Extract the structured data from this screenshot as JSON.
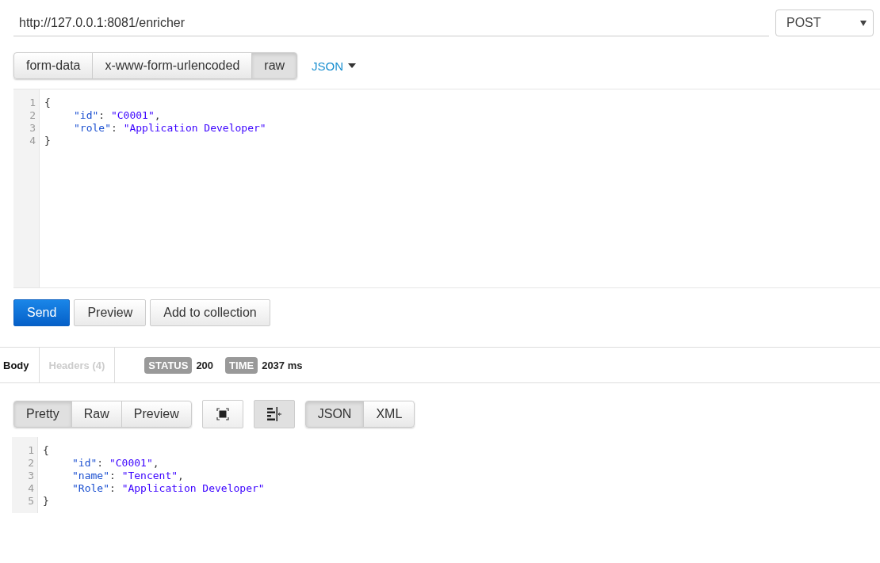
{
  "request": {
    "url": "http://127.0.0.1:8081/enricher",
    "method": "POST"
  },
  "body_modes": [
    {
      "label": "form-data",
      "selected": false
    },
    {
      "label": "x-www-form-urlencoded",
      "selected": false
    },
    {
      "label": "raw",
      "selected": true
    }
  ],
  "raw_type": "JSON",
  "request_body": [
    {
      "number": "1",
      "indented": false,
      "tokens": [
        {
          "kind": "punct",
          "text": "{"
        }
      ]
    },
    {
      "number": "2",
      "indented": true,
      "tokens": [
        {
          "kind": "key",
          "text": "\"id\""
        },
        {
          "kind": "punct",
          "text": ": "
        },
        {
          "kind": "string",
          "text": "\"C0001\""
        },
        {
          "kind": "punct",
          "text": ","
        }
      ]
    },
    {
      "number": "3",
      "indented": true,
      "tokens": [
        {
          "kind": "key",
          "text": "\"role\""
        },
        {
          "kind": "punct",
          "text": ": "
        },
        {
          "kind": "string",
          "text": "\"Application Developer\""
        }
      ]
    },
    {
      "number": "4",
      "indented": false,
      "tokens": [
        {
          "kind": "punct",
          "text": "}"
        }
      ]
    }
  ],
  "actions": [
    {
      "label": "Send",
      "kind": "primary"
    },
    {
      "label": "Preview",
      "kind": "default"
    },
    {
      "label": "Add to collection",
      "kind": "default"
    }
  ],
  "response_tabs": [
    {
      "label": "Body",
      "selected": true
    },
    {
      "label": "Headers (4)",
      "selected": false
    }
  ],
  "status": {
    "label": "STATUS",
    "value": "200"
  },
  "time": {
    "label": "TIME",
    "value": "2037 ms"
  },
  "view_modes": [
    {
      "label": "Pretty",
      "selected": true
    },
    {
      "label": "Raw",
      "selected": false
    },
    {
      "label": "Preview",
      "selected": false
    }
  ],
  "fullscreen_on": false,
  "wrap_on": true,
  "formats": [
    {
      "label": "JSON",
      "selected": true
    },
    {
      "label": "XML",
      "selected": false
    }
  ],
  "response_body": [
    {
      "number": "1",
      "indented": false,
      "tokens": [
        {
          "kind": "punct",
          "text": "{"
        }
      ]
    },
    {
      "number": "2",
      "indented": true,
      "tokens": [
        {
          "kind": "key",
          "text": "\"id\""
        },
        {
          "kind": "punct",
          "text": ": "
        },
        {
          "kind": "string",
          "text": "\"C0001\""
        },
        {
          "kind": "punct",
          "text": ","
        }
      ]
    },
    {
      "number": "3",
      "indented": true,
      "tokens": [
        {
          "kind": "key",
          "text": "\"name\""
        },
        {
          "kind": "punct",
          "text": ": "
        },
        {
          "kind": "string",
          "text": "\"Tencent\""
        },
        {
          "kind": "punct",
          "text": ","
        }
      ]
    },
    {
      "number": "4",
      "indented": true,
      "tokens": [
        {
          "kind": "key",
          "text": "\"Role\""
        },
        {
          "kind": "punct",
          "text": ": "
        },
        {
          "kind": "string",
          "text": "\"Application Developer\""
        }
      ]
    },
    {
      "number": "5",
      "indented": false,
      "tokens": [
        {
          "kind": "punct",
          "text": "}"
        }
      ]
    }
  ]
}
